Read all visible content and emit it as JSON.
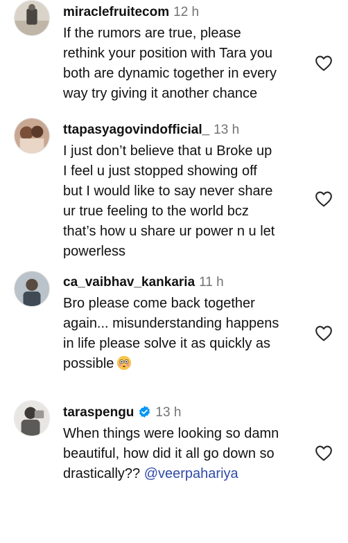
{
  "comments": [
    {
      "username": "miraclefruitecom",
      "time": "12 h",
      "lines": [
        "If the rumors are true, please",
        "rethink your position with Tara you",
        "both are dynamic together in every",
        "way try giving it another chance"
      ],
      "avatar_icon": "avatar-icon"
    },
    {
      "username": "ttapasyagovindofficial_",
      "time": "13 h",
      "lines": [
        "I just don’t believe that u Broke up",
        "I feel u just stopped showing off",
        "but I would like to say never share",
        "ur true feeling to the world bcz",
        "that’s how u share ur power n u let",
        "powerless"
      ],
      "avatar_icon": "avatar-icon"
    },
    {
      "username": "ca_vaibhav_kankaria",
      "time": "11 h",
      "lines": [
        "Bro please come back together",
        "again... misunderstanding happens",
        "in life please solve it as quickly as",
        "possible"
      ],
      "emoji": "flushed-face-emoji",
      "avatar_icon": "avatar-icon"
    },
    {
      "username": "taraspengu",
      "verified": true,
      "time": "13 h",
      "lines": [
        "When things were looking so damn",
        "beautiful, how did it all go down so",
        "drastically?? "
      ],
      "mention": "@veerpahariya",
      "avatar_icon": "avatar-icon"
    }
  ],
  "colors": {
    "text": "#111111",
    "muted": "#737373",
    "mention": "#2f4aa8",
    "verified": "#0095f6"
  },
  "icons": {
    "like": "heart-outline-icon",
    "verified": "verified-badge-icon"
  }
}
